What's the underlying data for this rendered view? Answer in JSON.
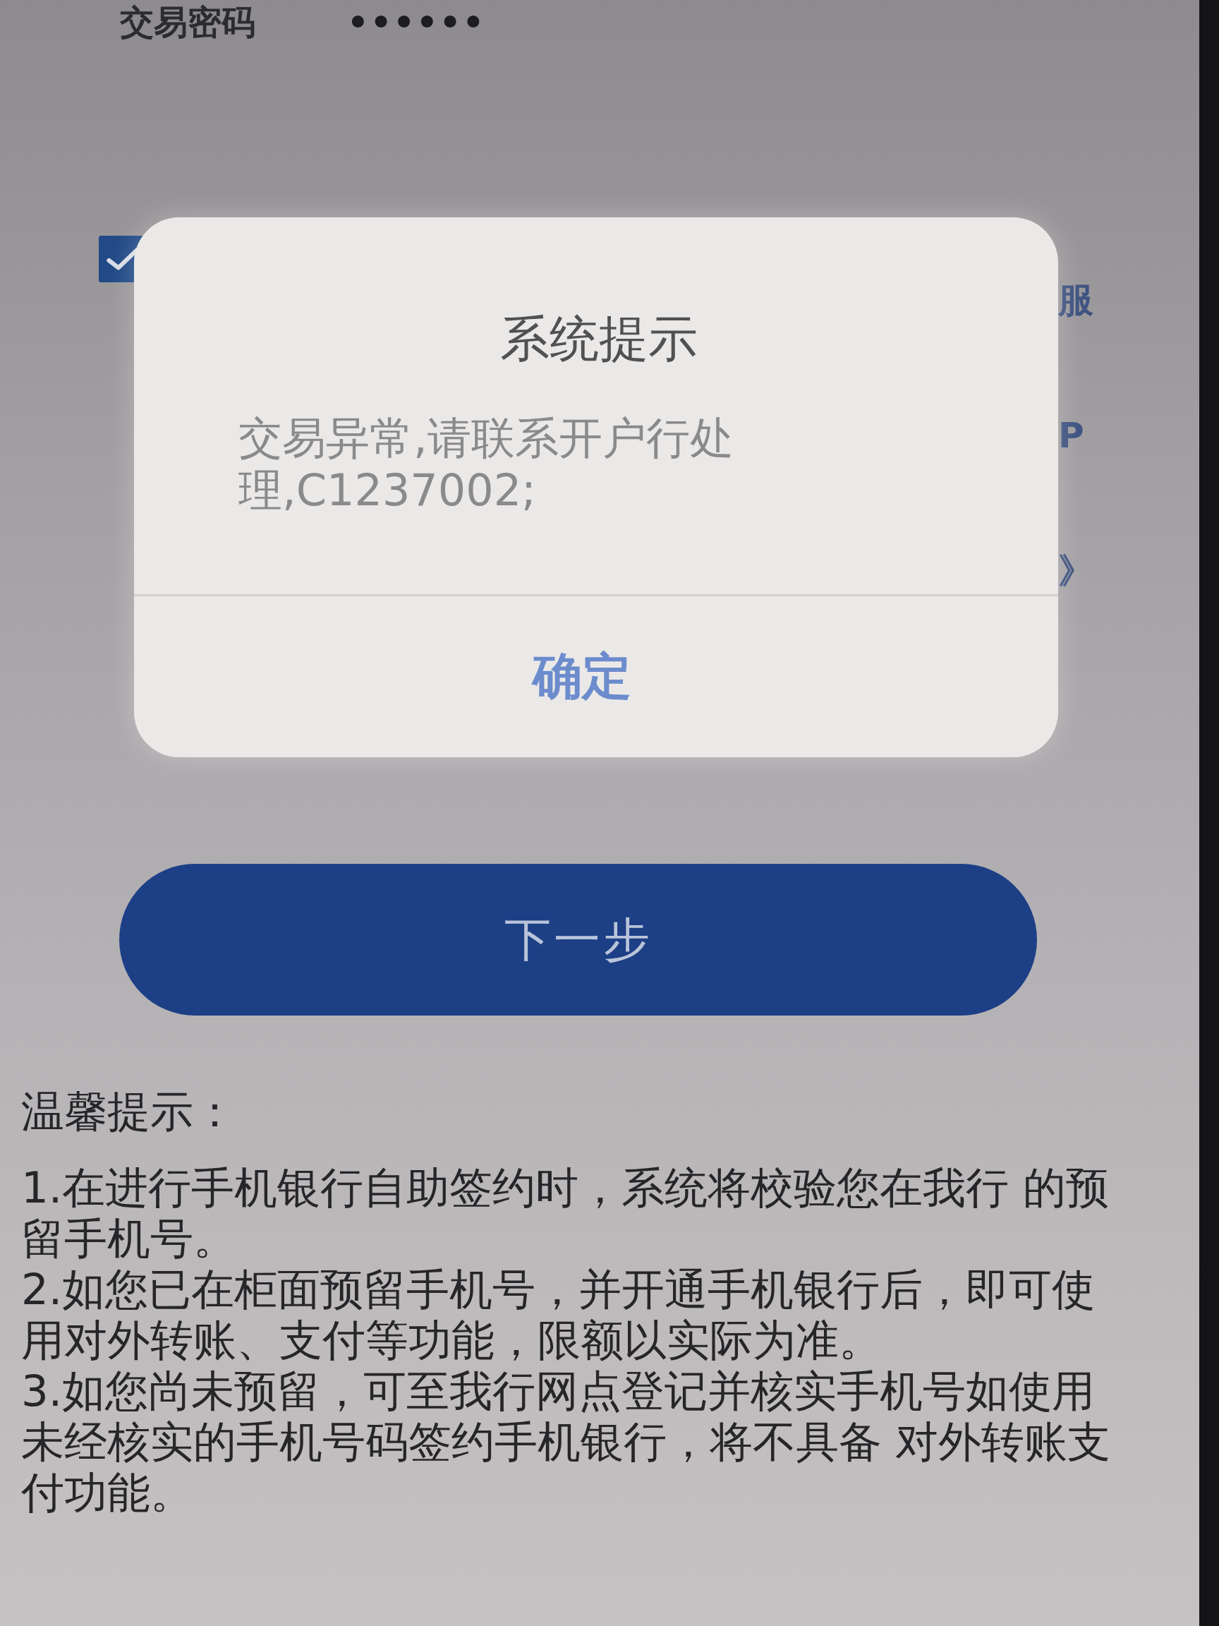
{
  "password_row": {
    "label": "交易密码",
    "value": "••••••"
  },
  "agreement": {
    "checked": true,
    "fragments": [
      "服",
      "P",
      "》"
    ]
  },
  "next_button": {
    "label": "下一步"
  },
  "tips": {
    "title": "温馨提示：",
    "items": [
      "1.在进行手机银行自助签约时，系统将校验您在我行 的预留手机号。",
      "2.如您已在柜面预留手机号，并开通手机银行后，即可使用对外转账、支付等功能，限额以实际为准。",
      "3.如您尚未预留，可至我行网点登记并核实手机号如使用未经核实的手机号码签约手机银行，将不具备 对外转账支付功能。"
    ]
  },
  "dialog": {
    "title": "系统提示",
    "message": "交易异常,请联系开户行处理,C1237002;",
    "buttons": [
      "确定"
    ]
  }
}
